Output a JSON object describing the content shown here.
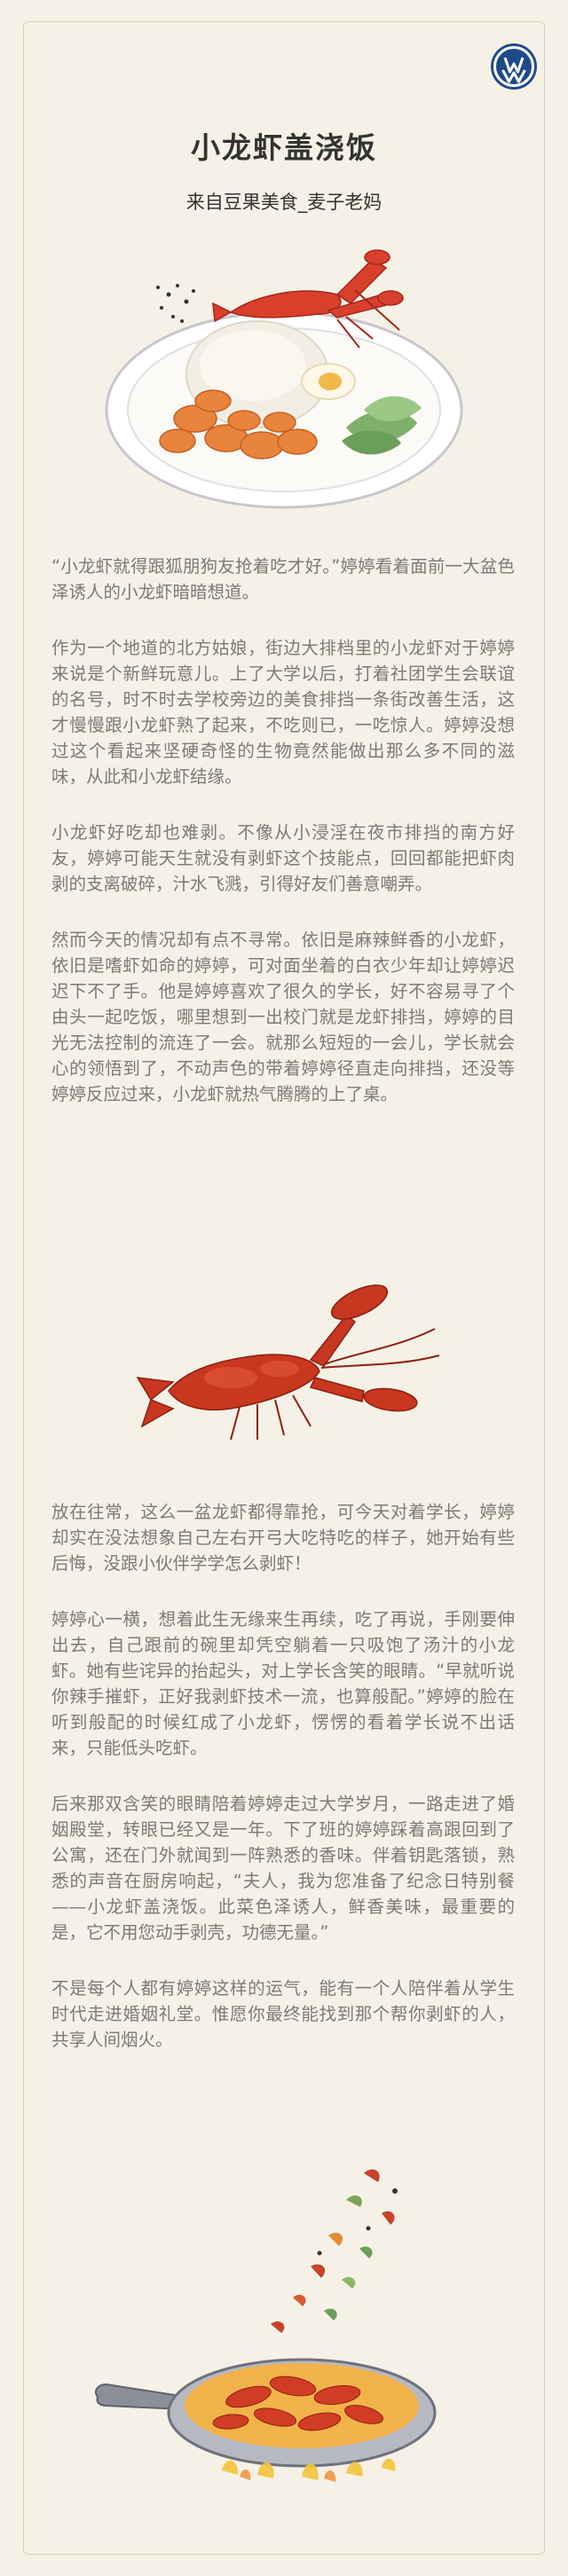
{
  "brand": {
    "logo": "volkswagen-logo"
  },
  "header": {
    "title": "小龙虾盖浇饭",
    "subtitle": "来自豆果美食_麦子老妈"
  },
  "images": {
    "top": "crayfish-rice-plate-illustration",
    "middle": "crayfish-illustration",
    "bottom": "crayfish-pan-illustration"
  },
  "article": {
    "section1": [
      "“小龙虾就得跟狐朋狗友抢着吃才好。”婷婷看着面前一大盆色泽诱人的小龙虾暗暗想道。",
      "作为一个地道的北方姑娘，街边大排档里的小龙虾对于婷婷来说是个新鲜玩意儿。上了大学以后，打着社团学生会联谊的名号，时不时去学校旁边的美食排挡一条街改善生活，这才慢慢跟小龙虾熟了起来，不吃则已，一吃惊人。婷婷没想过这个看起来坚硬奇怪的生物竟然能做出那么多不同的滋味，从此和小龙虾结缘。",
      "小龙虾好吃却也难剥。不像从小浸淫在夜市排挡的南方好友，婷婷可能天生就没有剥虾这个技能点，回回都能把虾肉剥的支离破碎，汁水飞溅，引得好友们善意嘲弄。",
      "然而今天的情况却有点不寻常。依旧是麻辣鲜香的小龙虾，依旧是嗜虾如命的婷婷，可对面坐着的白衣少年却让婷婷迟迟下不了手。他是婷婷喜欢了很久的学长，好不容易寻了个由头一起吃饭，哪里想到一出校门就是龙虾排挡，婷婷的目光无法控制的流连了一会。就那么短短的一会儿，学长就会心的领悟到了，不动声色的带着婷婷径直走向排挡，还没等婷婷反应过来，小龙虾就热气腾腾的上了桌。"
    ],
    "section2": [
      "放在往常，这么一盆龙虾都得靠抢，可今天对着学长，婷婷却实在没法想象自己左右开弓大吃特吃的样子，她开始有些后悔，没跟小伙伴学学怎么剥虾！",
      "婷婷心一横，想着此生无缘来生再续，吃了再说，手刚要伸出去，自己跟前的碗里却凭空躺着一只吸饱了汤汁的小龙虾。她有些诧异的抬起头，对上学长含笑的眼睛。“早就听说你辣手摧虾，正好我剥虾技术一流，也算般配。”婷婷的脸在听到般配的时候红成了小龙虾，愣愣的看着学长说不出话来，只能低头吃虾。",
      "后来那双含笑的眼睛陪着婷婷走过大学岁月，一路走进了婚姻殿堂，转眼已经又是一年。下了班的婷婷踩着高跟回到了公寓，还在门外就闻到一阵熟悉的香味。伴着钥匙落锁，熟悉的声音在厨房响起，“夫人，我为您准备了纪念日特别餐——小龙虾盖浇饭。此菜色泽诱人，鲜香美味，最重要的是，它不用您动手剥壳，功德无量。”",
      "不是每个人都有婷婷这样的运气，能有一个人陪伴着从学生时代走进婚姻礼堂。惟愿你最终能找到那个帮你剥虾的人，共享人间烟火。"
    ]
  }
}
